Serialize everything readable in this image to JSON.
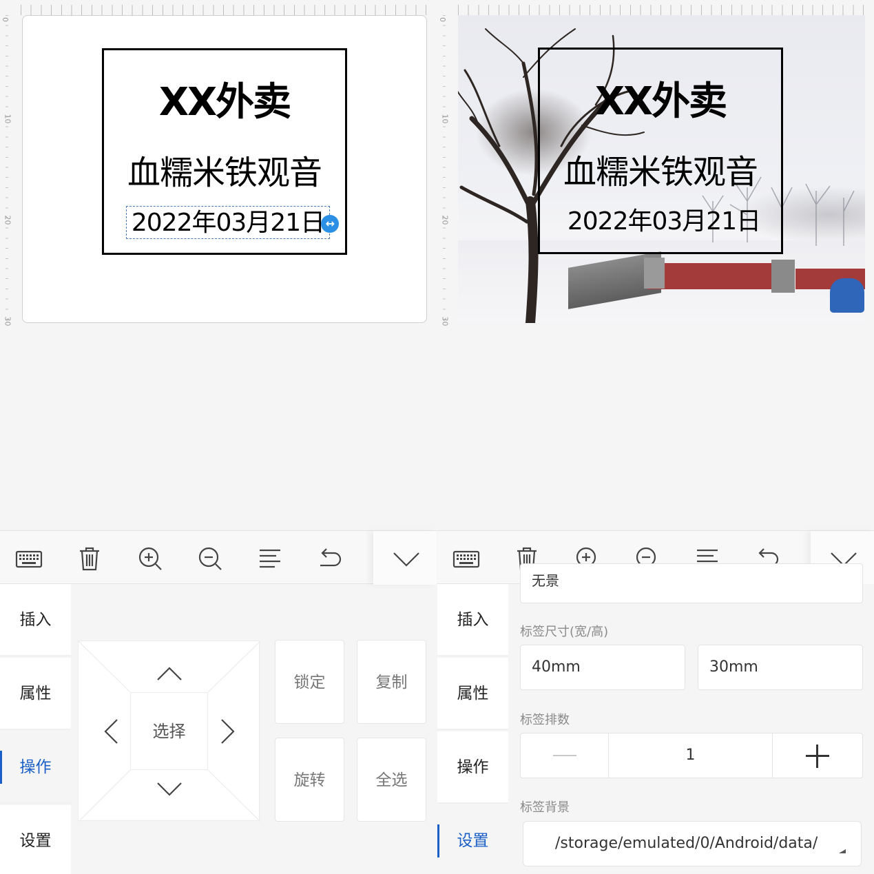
{
  "ruler": {
    "ticks": [
      "0",
      "10",
      "20",
      "30"
    ]
  },
  "label": {
    "title": "XX外卖",
    "product": "血糯米铁观音",
    "date": "2022年03月21日"
  },
  "toolbar": {
    "icons": [
      "keyboard-icon",
      "delete-icon",
      "zoom-in-icon",
      "zoom-out-icon",
      "align-icon",
      "undo-icon",
      "collapse-chevron-icon"
    ]
  },
  "nav": {
    "items": [
      {
        "label": "插入"
      },
      {
        "label": "属性"
      },
      {
        "label": "操作"
      },
      {
        "label": "设置"
      }
    ]
  },
  "operate": {
    "select": "选择",
    "lock": "锁定",
    "copy": "复制",
    "rotate": "旋转",
    "select_all": "全选"
  },
  "settings": {
    "top_value": "无景",
    "size_label": "标签尺寸(宽/高)",
    "width": "40mm",
    "height": "30mm",
    "count_label": "标签排数",
    "count": "1",
    "background_label": "标签背景",
    "background_path": "/storage/emulated/0/Android/data/"
  },
  "colors": {
    "accent": "#1a5fc7",
    "handle": "#2b8fe6"
  }
}
